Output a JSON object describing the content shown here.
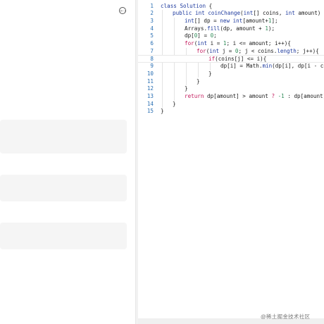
{
  "editor": {
    "lines": [
      {
        "n": "1",
        "indent": 0,
        "tokens": [
          {
            "t": "class ",
            "c": "kw"
          },
          {
            "t": "Solution",
            "c": "ty"
          },
          {
            "t": " {",
            "c": ""
          }
        ]
      },
      {
        "n": "2",
        "indent": 1,
        "tokens": [
          {
            "t": "public ",
            "c": "kw"
          },
          {
            "t": "int ",
            "c": "kw"
          },
          {
            "t": "coinChange",
            "c": "ty"
          },
          {
            "t": "(",
            "c": ""
          },
          {
            "t": "int",
            "c": "kw"
          },
          {
            "t": "[] coins, ",
            "c": ""
          },
          {
            "t": "int ",
            "c": "kw"
          },
          {
            "t": "amount) {",
            "c": ""
          }
        ]
      },
      {
        "n": "3",
        "indent": 2,
        "tokens": [
          {
            "t": "int",
            "c": "kw"
          },
          {
            "t": "[] dp = ",
            "c": ""
          },
          {
            "t": "new ",
            "c": "kw"
          },
          {
            "t": "int",
            "c": "kw"
          },
          {
            "t": "[amount+",
            "c": ""
          },
          {
            "t": "1",
            "c": "num"
          },
          {
            "t": "];",
            "c": ""
          }
        ]
      },
      {
        "n": "4",
        "indent": 2,
        "tokens": [
          {
            "t": "Arrays",
            "c": ""
          },
          {
            "t": ".",
            "c": ""
          },
          {
            "t": "fill",
            "c": "ty"
          },
          {
            "t": "(dp, amount + ",
            "c": ""
          },
          {
            "t": "1",
            "c": "num"
          },
          {
            "t": ");",
            "c": ""
          }
        ]
      },
      {
        "n": "5",
        "indent": 2,
        "tokens": [
          {
            "t": "dp[",
            "c": ""
          },
          {
            "t": "0",
            "c": "num"
          },
          {
            "t": "] = ",
            "c": ""
          },
          {
            "t": "0",
            "c": "num"
          },
          {
            "t": ";",
            "c": ""
          }
        ]
      },
      {
        "n": "6",
        "indent": 2,
        "tokens": [
          {
            "t": "for",
            "c": "op"
          },
          {
            "t": "(",
            "c": ""
          },
          {
            "t": "int ",
            "c": "kw"
          },
          {
            "t": "i = ",
            "c": ""
          },
          {
            "t": "1",
            "c": "num"
          },
          {
            "t": "; i <= amount; i++){",
            "c": ""
          }
        ]
      },
      {
        "n": "7",
        "indent": 3,
        "tokens": [
          {
            "t": "for",
            "c": "op"
          },
          {
            "t": "(",
            "c": ""
          },
          {
            "t": "int ",
            "c": "kw"
          },
          {
            "t": "j = ",
            "c": ""
          },
          {
            "t": "0",
            "c": "num"
          },
          {
            "t": "; j < coins.",
            "c": ""
          },
          {
            "t": "length",
            "c": "kw"
          },
          {
            "t": "; j++){",
            "c": ""
          }
        ]
      },
      {
        "n": "8",
        "indent": 4,
        "tokens": [
          {
            "t": "if",
            "c": "op"
          },
          {
            "t": "(coins[j] <= i){",
            "c": ""
          }
        ]
      },
      {
        "n": "9",
        "indent": 5,
        "tokens": [
          {
            "t": "dp[i] = ",
            "c": ""
          },
          {
            "t": "Math",
            "c": ""
          },
          {
            "t": ".",
            "c": ""
          },
          {
            "t": "min",
            "c": "ty"
          },
          {
            "t": "(dp[i], dp[i - coin",
            "c": ""
          }
        ]
      },
      {
        "n": "10",
        "indent": 4,
        "tokens": [
          {
            "t": "}",
            "c": ""
          }
        ]
      },
      {
        "n": "11",
        "indent": 3,
        "tokens": [
          {
            "t": "}",
            "c": ""
          }
        ]
      },
      {
        "n": "12",
        "indent": 2,
        "tokens": [
          {
            "t": "}",
            "c": ""
          }
        ]
      },
      {
        "n": "13",
        "indent": 2,
        "tokens": [
          {
            "t": "return ",
            "c": "op"
          },
          {
            "t": "dp[amount] > amount ",
            "c": ""
          },
          {
            "t": "? ",
            "c": "op"
          },
          {
            "t": "-1 ",
            "c": "num"
          },
          {
            "t": ": dp[amount];",
            "c": ""
          }
        ]
      },
      {
        "n": "14",
        "indent": 1,
        "tokens": [
          {
            "t": "}",
            "c": ""
          }
        ]
      },
      {
        "n": "15",
        "indent": 0,
        "tokens": [
          {
            "t": "}",
            "c": ""
          }
        ]
      }
    ],
    "active_line": 8
  },
  "colors": {
    "keyword": "#1e3a9e",
    "number": "#2e8b57",
    "control": "#c2185b",
    "line_number": "#2a6fb3",
    "card_bg": "#f5f5f5"
  },
  "icons": {
    "more": "more-horizontal-circle-icon"
  },
  "watermark": {
    "text": "@稀土掘金技术社区"
  }
}
